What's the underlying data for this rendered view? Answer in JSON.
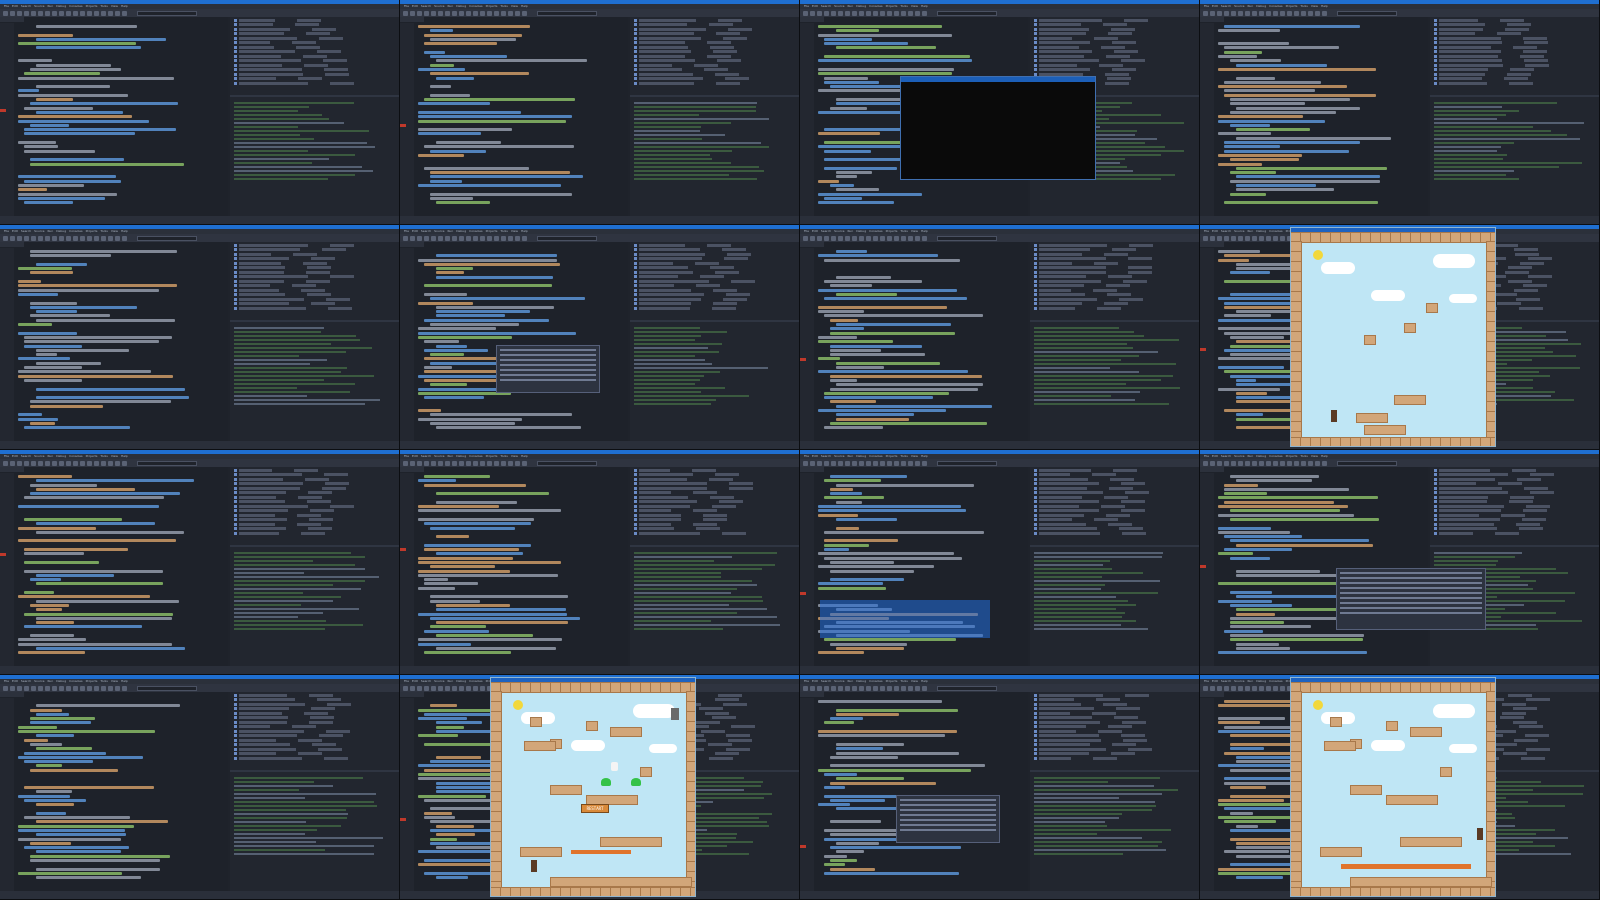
{
  "menu": [
    "File",
    "Edit",
    "Search",
    "Source",
    "Run",
    "Debug",
    "Consoles",
    "Projects",
    "Tools",
    "View",
    "Help"
  ],
  "colors": {
    "accent": "#1f6fd1",
    "editor_bg": "#1e222a",
    "code_blue": "#5e9be0",
    "code_green": "#8fc46a",
    "code_orange": "#d7a26a",
    "code_gray": "#9aa3b2",
    "sky": "#bfe6f5",
    "brick": "#d2a679",
    "lava": "#e0742c"
  },
  "game_window": {
    "restart_label": "RESTART"
  },
  "layout_pattern": [
    "code",
    "code",
    "terminal",
    "code",
    "code",
    "code",
    "code",
    "game",
    "code",
    "code",
    "code",
    "code",
    "code",
    "game-restart",
    "code",
    "game"
  ]
}
